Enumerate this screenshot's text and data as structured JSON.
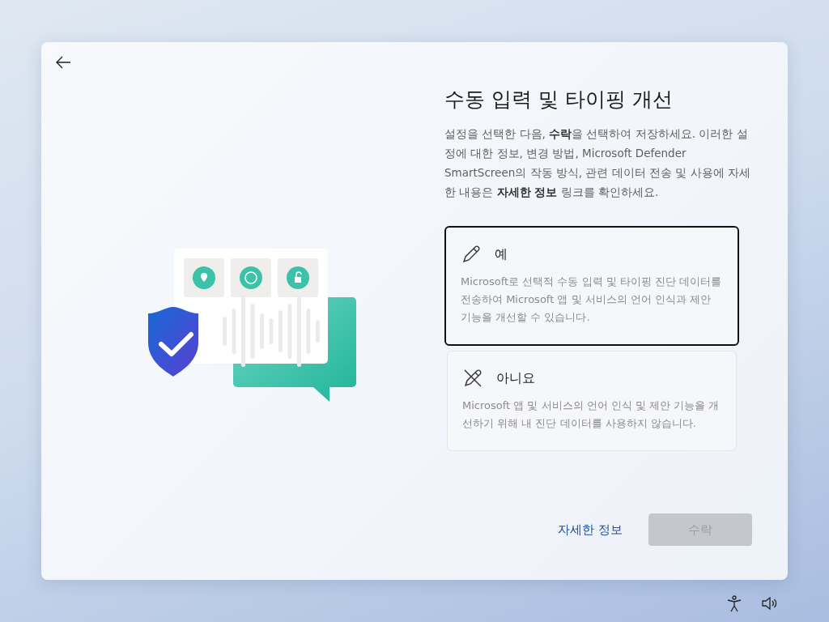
{
  "title": "수동 입력 및 타이핑 개선",
  "description": "설정을 선택한 다음, **수락**을 선택하여 저장하세요. 이러한 설정에 대한 정보, 변경 방법, Microsoft Defender SmartScreen의 작동 방식, 관련 데이터 전송 및 사용에 자세한 내용은 **자세한 정보** 링크를 확인하세요.",
  "options": [
    {
      "kind": "yes",
      "label": "예",
      "detail": "Microsoft로 선택적 수동 입력 및 타이핑 진단 데이터를 전송하여 Microsoft 앱 및 서비스의 언어 인식과 제안 기능을 개선할 수 있습니다.",
      "selected": true
    },
    {
      "kind": "no",
      "label": "아니요",
      "detail": "Microsoft 앱 및 서비스의 언어 인식 및 제안 기능을 개선하기 위해 내 진단 데이터를 사용하지 않습니다.",
      "selected": false
    }
  ],
  "learn_more_link": "자세한 정보",
  "accept_button": {
    "label": "수락",
    "disabled": true
  }
}
